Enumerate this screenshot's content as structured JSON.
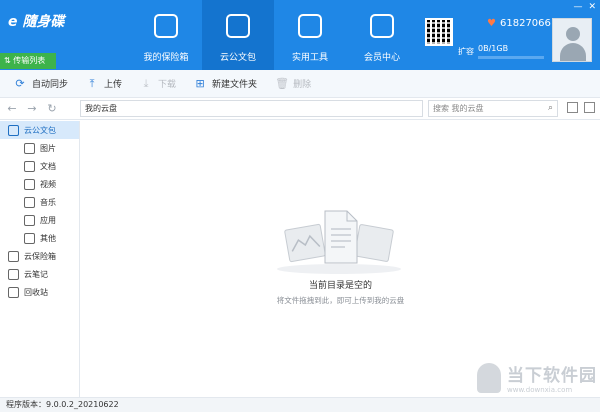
{
  "header": {
    "logo_text": "e 隨身碟",
    "transfer_label": "传输列表",
    "nav": [
      {
        "label": "我的保险箱",
        "icon": "safe-icon"
      },
      {
        "label": "云公文包",
        "icon": "cloud-briefcase-icon",
        "active": true
      },
      {
        "label": "实用工具",
        "icon": "toolbox-icon"
      },
      {
        "label": "会员中心",
        "icon": "member-icon"
      }
    ],
    "user_id": "61827066",
    "expand_label": "扩容",
    "quota_text": "0B/1GB",
    "quota_used_fraction": 0.0
  },
  "toolbar": {
    "sync": "自动同步",
    "upload": "上传",
    "download": "下载",
    "new_folder": "新建文件夹",
    "delete": "删除"
  },
  "address": {
    "path": "我的云盘",
    "search_placeholder": "搜索 我的云盘"
  },
  "sidebar": {
    "items": [
      {
        "label": "云公文包",
        "level": "top",
        "icon": "briefcase-icon",
        "active": true
      },
      {
        "label": "图片",
        "level": "sub",
        "icon": "image-icon"
      },
      {
        "label": "文档",
        "level": "sub",
        "icon": "document-icon"
      },
      {
        "label": "视频",
        "level": "sub",
        "icon": "video-icon"
      },
      {
        "label": "音乐",
        "level": "sub",
        "icon": "music-icon"
      },
      {
        "label": "应用",
        "level": "sub",
        "icon": "app-icon"
      },
      {
        "label": "其他",
        "level": "sub",
        "icon": "other-icon"
      },
      {
        "label": "云保险箱",
        "level": "top",
        "icon": "safe-icon"
      },
      {
        "label": "云笔记",
        "level": "top",
        "icon": "notes-icon"
      },
      {
        "label": "回收站",
        "level": "top",
        "icon": "recycle-icon"
      }
    ]
  },
  "main": {
    "empty_title": "当前目录是空的",
    "empty_subtitle": "将文件拖拽到此，即可上传到我的云盘"
  },
  "watermark": {
    "cn": "当下软件园",
    "en": "www.downxia.com"
  },
  "status": {
    "version": "程序版本：9.0.0.2_20210622"
  },
  "colors": {
    "header_bg": "#1f87e6",
    "transfer_btn": "#3db34a",
    "accent": "#2f7fd8"
  }
}
